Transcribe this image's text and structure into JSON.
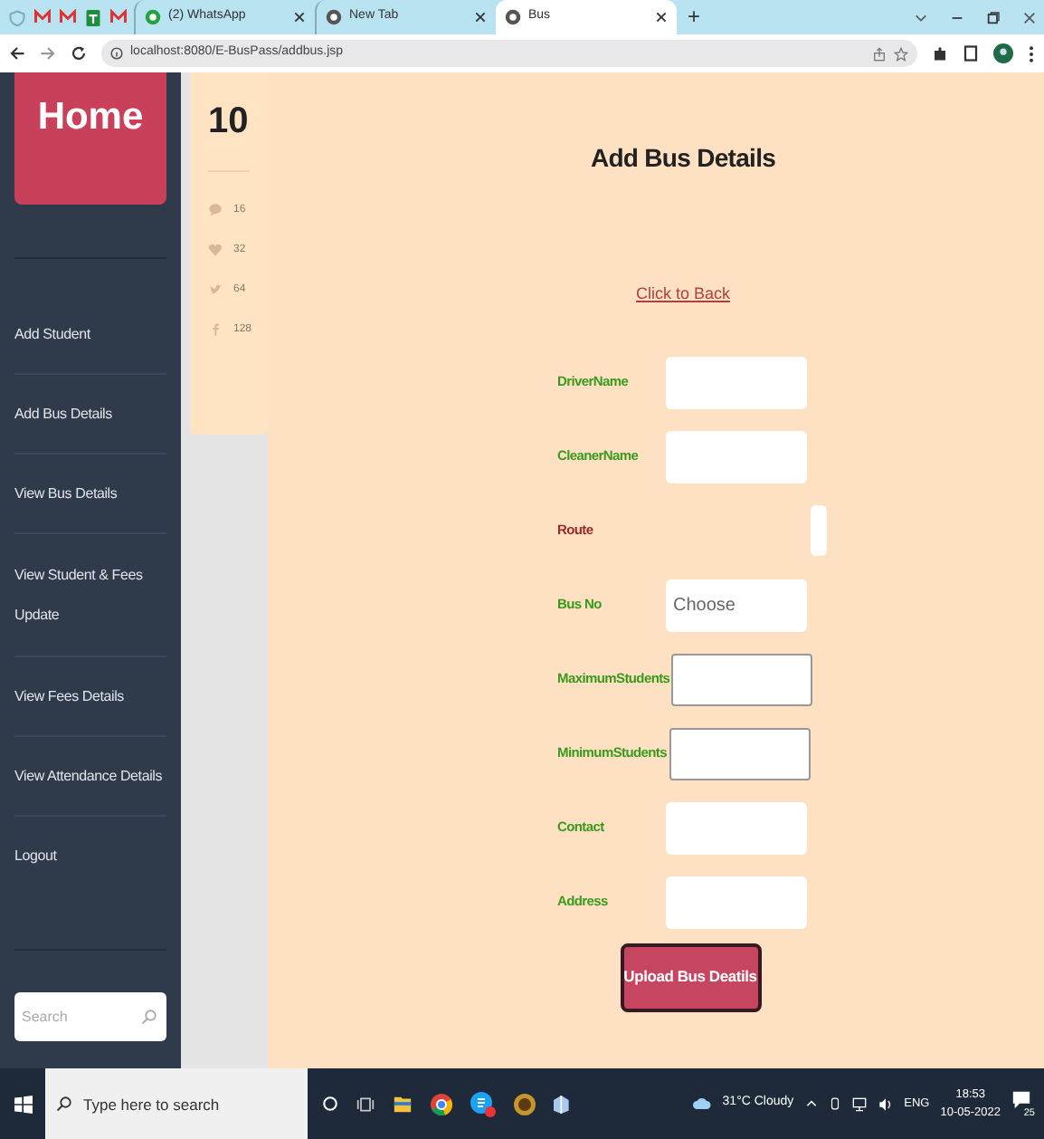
{
  "browser": {
    "tabs": [
      {
        "title": "(2) WhatsApp",
        "selected": false
      },
      {
        "title": "New Tab",
        "selected": false
      },
      {
        "title": "Bus",
        "selected": true
      }
    ],
    "new_tab": "+",
    "url": "localhost:8080/E-BusPass/addbus.jsp"
  },
  "sidebar": {
    "home": "Home",
    "items": [
      {
        "label": "Add Student"
      },
      {
        "label": "Add Bus Details"
      },
      {
        "label": "View Bus Details"
      },
      {
        "label": "View Student & Fees Update"
      },
      {
        "label": "View Fees Details"
      },
      {
        "label": "View Attendance Details"
      },
      {
        "label": "Logout"
      }
    ],
    "search": {
      "placeholder": "Search"
    }
  },
  "stats": {
    "count": "10",
    "items": [
      {
        "kind": "comment",
        "value": "16"
      },
      {
        "kind": "heart",
        "value": "32"
      },
      {
        "kind": "bird",
        "value": "64"
      },
      {
        "kind": "f",
        "value": "128"
      }
    ]
  },
  "form": {
    "title": "Add Bus Details",
    "back_link": "Click to Back",
    "fields": [
      {
        "label": "DriverName",
        "kind": "input",
        "color": "#3a9a1e"
      },
      {
        "label": "CleanerName",
        "kind": "input",
        "color": "#3a9a1e"
      },
      {
        "label": "Route",
        "kind": "small-select",
        "color": "#9a2a2a"
      },
      {
        "label": "Bus No",
        "kind": "input",
        "placeholder": "Choose",
        "color": "#3a9a1e"
      },
      {
        "label": "MaximumStudents",
        "kind": "outlined",
        "color": "#3a9a1e"
      },
      {
        "label": "MinimumStudents",
        "kind": "outlined",
        "color": "#3a9a1e"
      },
      {
        "label": "Contact",
        "kind": "input",
        "color": "#3a9a1e"
      },
      {
        "label": "Address",
        "kind": "input",
        "color": "#3a9a1e"
      }
    ],
    "submit": "Upload Bus Deatils"
  },
  "taskbar": {
    "search_placeholder": "Type here to search",
    "weather": "31°C Cloudy",
    "language": "ENG",
    "time": "18:53",
    "date": "10-05-2022",
    "notification_count": "25"
  }
}
